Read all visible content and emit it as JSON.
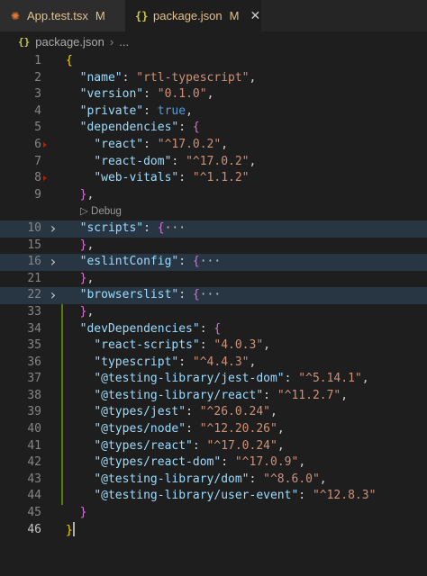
{
  "tabs": [
    {
      "name": "App.test.tsx",
      "status": "M",
      "icon": "react-icon",
      "active": false
    },
    {
      "name": "package.json",
      "status": "M",
      "icon": "json-braces-icon",
      "active": true,
      "close": "✕"
    }
  ],
  "breadcrumb": {
    "icon_glyph": "{}",
    "file": "package.json",
    "separator": "›",
    "more": "..."
  },
  "codelens": {
    "label": "Debug",
    "icon_glyph": "▷"
  },
  "lines": [
    {
      "n": "1",
      "tokens": [
        [
          "br1",
          "{"
        ]
      ]
    },
    {
      "n": "2",
      "tokens": [
        [
          "p",
          "  "
        ],
        [
          "k",
          "\"name\""
        ],
        [
          "p",
          ": "
        ],
        [
          "s",
          "\"rtl-typescript\""
        ],
        [
          "p",
          ","
        ]
      ]
    },
    {
      "n": "3",
      "tokens": [
        [
          "p",
          "  "
        ],
        [
          "k",
          "\"version\""
        ],
        [
          "p",
          ": "
        ],
        [
          "s",
          "\"0.1.0\""
        ],
        [
          "p",
          ","
        ]
      ]
    },
    {
      "n": "4",
      "tokens": [
        [
          "p",
          "  "
        ],
        [
          "k",
          "\"private\""
        ],
        [
          "p",
          ": "
        ],
        [
          "b",
          "true"
        ],
        [
          "p",
          ","
        ]
      ]
    },
    {
      "n": "5",
      "tokens": [
        [
          "p",
          "  "
        ],
        [
          "k",
          "\"dependencies\""
        ],
        [
          "p",
          ": "
        ],
        [
          "br2",
          "{"
        ]
      ]
    },
    {
      "n": "6",
      "tokens": [
        [
          "p",
          "    "
        ],
        [
          "k",
          "\"react\""
        ],
        [
          "p",
          ": "
        ],
        [
          "s",
          "\"^17.0.2\""
        ],
        [
          "p",
          ","
        ]
      ],
      "del": true
    },
    {
      "n": "7",
      "tokens": [
        [
          "p",
          "    "
        ],
        [
          "k",
          "\"react-dom\""
        ],
        [
          "p",
          ": "
        ],
        [
          "s",
          "\"^17.0.2\""
        ],
        [
          "p",
          ","
        ]
      ]
    },
    {
      "n": "8",
      "tokens": [
        [
          "p",
          "    "
        ],
        [
          "k",
          "\"web-vitals\""
        ],
        [
          "p",
          ": "
        ],
        [
          "s",
          "\"^1.1.2\""
        ]
      ],
      "del": true
    },
    {
      "n": "9",
      "tokens": [
        [
          "p",
          "  "
        ],
        [
          "br2",
          "}"
        ],
        [
          "p",
          ","
        ]
      ]
    },
    {
      "lens": true
    },
    {
      "n": "10",
      "tokens": [
        [
          "p",
          "  "
        ],
        [
          "k",
          "\"scripts\""
        ],
        [
          "p",
          ": "
        ],
        [
          "br2",
          "{"
        ],
        [
          "ell",
          "···"
        ]
      ],
      "fold": true
    },
    {
      "n": "15",
      "tokens": [
        [
          "p",
          "  "
        ],
        [
          "br2",
          "}"
        ],
        [
          "p",
          ","
        ]
      ]
    },
    {
      "n": "16",
      "tokens": [
        [
          "p",
          "  "
        ],
        [
          "k",
          "\"eslintConfig\""
        ],
        [
          "p",
          ": "
        ],
        [
          "br2",
          "{"
        ],
        [
          "ell",
          "···"
        ]
      ],
      "fold": true
    },
    {
      "n": "21",
      "tokens": [
        [
          "p",
          "  "
        ],
        [
          "br2",
          "}"
        ],
        [
          "p",
          ","
        ]
      ]
    },
    {
      "n": "22",
      "tokens": [
        [
          "p",
          "  "
        ],
        [
          "k",
          "\"browserslist\""
        ],
        [
          "p",
          ": "
        ],
        [
          "br2",
          "{"
        ],
        [
          "ell",
          "···"
        ]
      ],
      "fold": true
    },
    {
      "n": "33",
      "tokens": [
        [
          "p",
          "  "
        ],
        [
          "br2",
          "}"
        ],
        [
          "p",
          ","
        ]
      ],
      "mod": true
    },
    {
      "n": "34",
      "tokens": [
        [
          "p",
          "  "
        ],
        [
          "k",
          "\"devDependencies\""
        ],
        [
          "p",
          ": "
        ],
        [
          "br2",
          "{"
        ]
      ],
      "mod": true
    },
    {
      "n": "35",
      "tokens": [
        [
          "p",
          "    "
        ],
        [
          "k",
          "\"react-scripts\""
        ],
        [
          "p",
          ": "
        ],
        [
          "s",
          "\"4.0.3\""
        ],
        [
          "p",
          ","
        ]
      ],
      "mod": true
    },
    {
      "n": "36",
      "tokens": [
        [
          "p",
          "    "
        ],
        [
          "k",
          "\"typescript\""
        ],
        [
          "p",
          ": "
        ],
        [
          "s",
          "\"^4.4.3\""
        ],
        [
          "p",
          ","
        ]
      ],
      "mod": true
    },
    {
      "n": "37",
      "tokens": [
        [
          "p",
          "    "
        ],
        [
          "k",
          "\"@testing-library/jest-dom\""
        ],
        [
          "p",
          ": "
        ],
        [
          "s",
          "\"^5.14.1\""
        ],
        [
          "p",
          ","
        ]
      ],
      "mod": true
    },
    {
      "n": "38",
      "tokens": [
        [
          "p",
          "    "
        ],
        [
          "k",
          "\"@testing-library/react\""
        ],
        [
          "p",
          ": "
        ],
        [
          "s",
          "\"^11.2.7\""
        ],
        [
          "p",
          ","
        ]
      ],
      "mod": true
    },
    {
      "n": "39",
      "tokens": [
        [
          "p",
          "    "
        ],
        [
          "k",
          "\"@types/jest\""
        ],
        [
          "p",
          ": "
        ],
        [
          "s",
          "\"^26.0.24\""
        ],
        [
          "p",
          ","
        ]
      ],
      "mod": true
    },
    {
      "n": "40",
      "tokens": [
        [
          "p",
          "    "
        ],
        [
          "k",
          "\"@types/node\""
        ],
        [
          "p",
          ": "
        ],
        [
          "s",
          "\"^12.20.26\""
        ],
        [
          "p",
          ","
        ]
      ],
      "mod": true
    },
    {
      "n": "41",
      "tokens": [
        [
          "p",
          "    "
        ],
        [
          "k",
          "\"@types/react\""
        ],
        [
          "p",
          ": "
        ],
        [
          "s",
          "\"^17.0.24\""
        ],
        [
          "p",
          ","
        ]
      ],
      "mod": true
    },
    {
      "n": "42",
      "tokens": [
        [
          "p",
          "    "
        ],
        [
          "k",
          "\"@types/react-dom\""
        ],
        [
          "p",
          ": "
        ],
        [
          "s",
          "\"^17.0.9\""
        ],
        [
          "p",
          ","
        ]
      ],
      "mod": true
    },
    {
      "n": "43",
      "tokens": [
        [
          "p",
          "    "
        ],
        [
          "k",
          "\"@testing-library/dom\""
        ],
        [
          "p",
          ": "
        ],
        [
          "s",
          "\"^8.6.0\""
        ],
        [
          "p",
          ","
        ]
      ],
      "mod": true
    },
    {
      "n": "44",
      "tokens": [
        [
          "p",
          "    "
        ],
        [
          "k",
          "\"@testing-library/user-event\""
        ],
        [
          "p",
          ": "
        ],
        [
          "s",
          "\"^12.8.3\""
        ]
      ],
      "mod": true
    },
    {
      "n": "45",
      "tokens": [
        [
          "p",
          "  "
        ],
        [
          "br2",
          "}"
        ]
      ]
    },
    {
      "n": "46",
      "tokens": [
        [
          "br1",
          "}"
        ]
      ],
      "current": true
    }
  ],
  "colors": {
    "key": "#9cdcfe",
    "string": "#ce9178",
    "boolean": "#569cd6",
    "bracket_outer": "#ffd700",
    "bracket_inner": "#da70d6",
    "modified_gutter": "#587c0c",
    "deleted_gutter": "#a1260d",
    "tab_modified_text": "#e2c08d"
  }
}
